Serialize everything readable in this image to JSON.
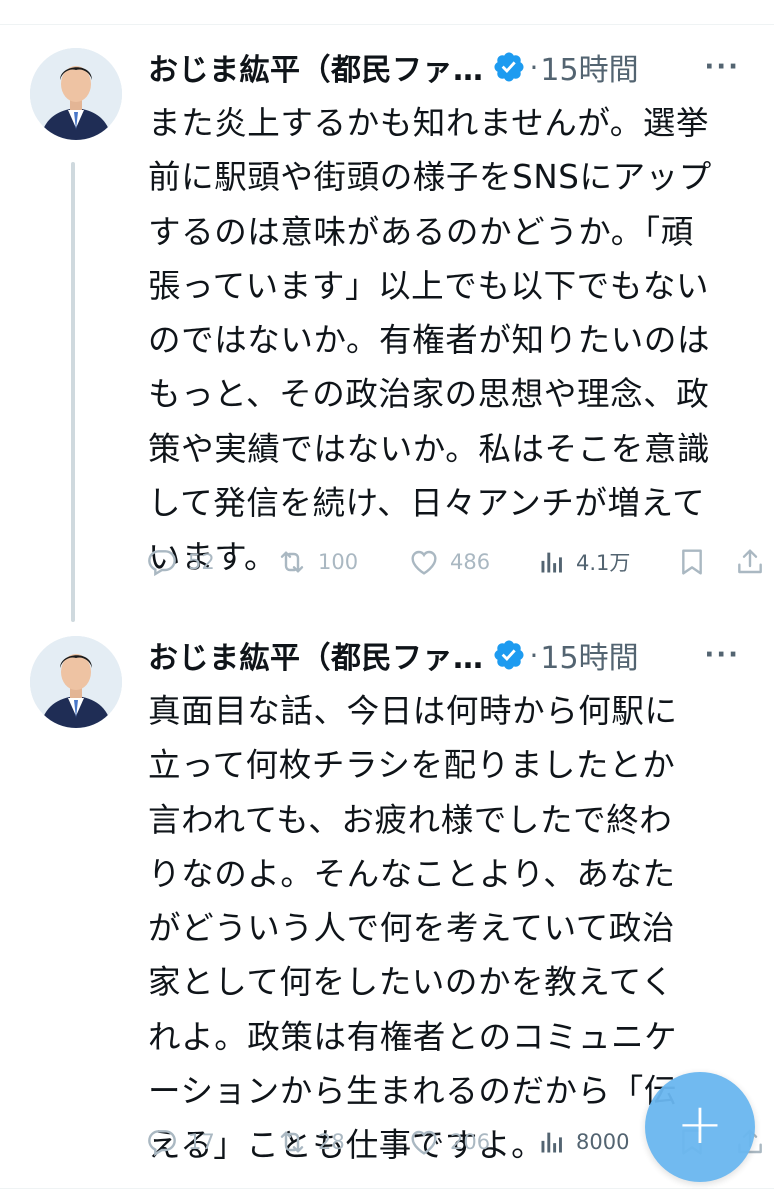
{
  "tweets": [
    {
      "author": "おじま紘平（都民ファ…",
      "separator": "·",
      "time": "15時間",
      "more": "···",
      "text": "また炎上するかも知れませんが。選挙\n前に駅頭や街頭の様子をSNSにアップ\nするのは意味があるのかどうか。「頑\n張っています」以上でも以下でもない\nのではないか。有権者が知りたいのは\nもっと、その政治家の思想や理念、政\n策や実績ではないか。私はそこを意識\nして発信を続け、日々アンチが増えて\nいます。",
      "replies": "52",
      "retweets": "100",
      "likes": "486",
      "views": "4.1万"
    },
    {
      "author": "おじま紘平（都民ファ…",
      "separator": "·",
      "time": "15時間",
      "more": "···",
      "text": "真面目な話、今日は何時から何駅に\n立って何枚チラシを配りましたとか\n言われても、お疲れ様でしたで終わ\nりなのよ。そんなことより、あなた\nがどういう人で何を考えていて政治\n家として何をしたいのかを教えてく\nれよ。政策は有権者とのコミュニケ\nーションから生まれるのだから「伝\nえる」ことも仕事ですよ。",
      "replies": "17",
      "retweets": "28",
      "likes": "206",
      "views": "8000"
    }
  ],
  "fab": {
    "label": "+"
  },
  "icons": {
    "verified": "verified-badge-icon",
    "reply": "reply-icon",
    "retweet": "retweet-icon",
    "like": "heart-icon",
    "views": "views-bar-chart-icon",
    "bookmark": "bookmark-icon",
    "share": "share-icon"
  },
  "colors": {
    "verified": "#1d9bf0",
    "muted": "#536471",
    "fab": "#6ab7f0"
  }
}
